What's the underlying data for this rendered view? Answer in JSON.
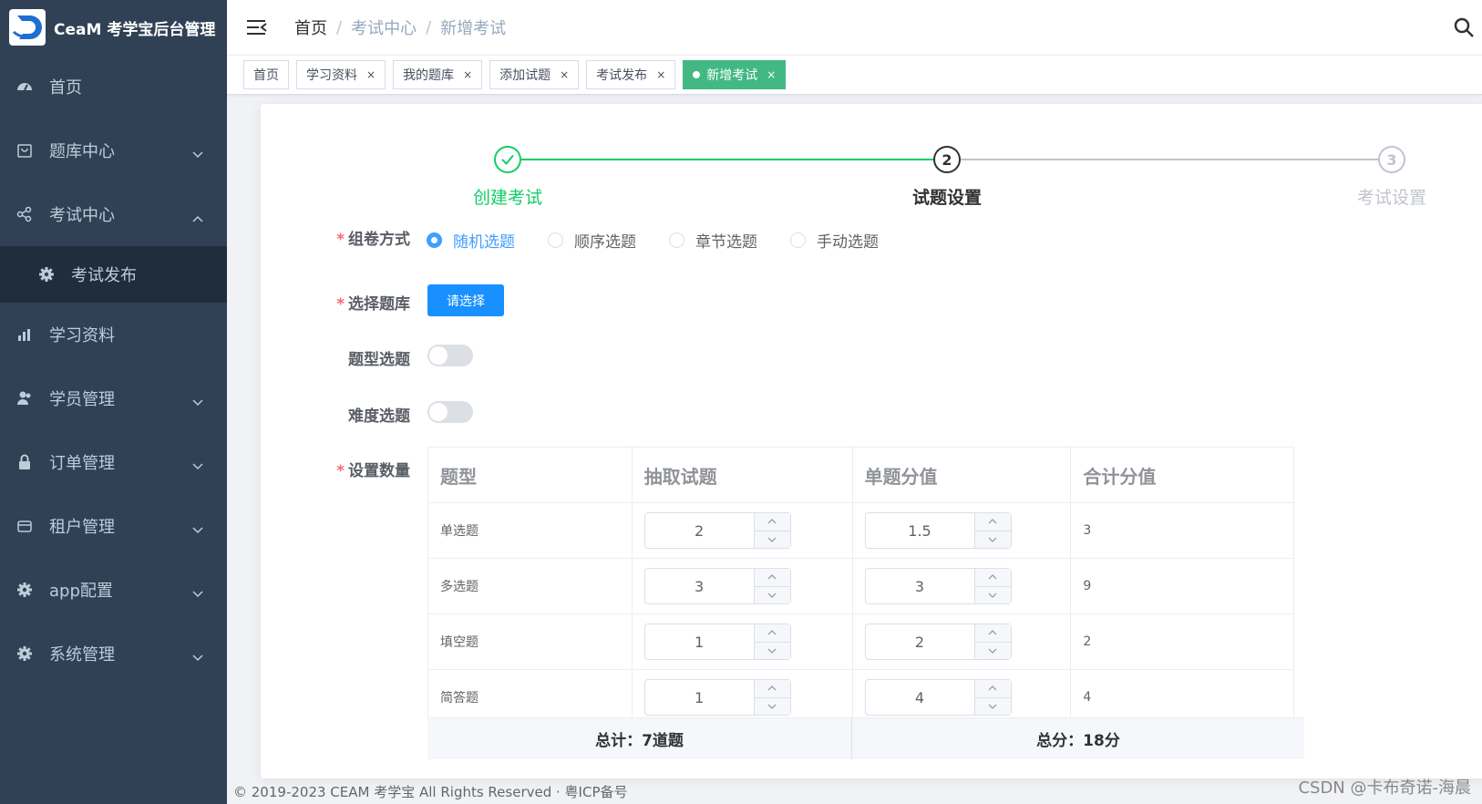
{
  "app": {
    "title": "CeaM 考学宝后台管理"
  },
  "sidebar": {
    "items": [
      {
        "label": "首页",
        "icon": "dashboard-icon",
        "arrow": ""
      },
      {
        "label": "题库中心",
        "icon": "shopping-icon",
        "arrow": "down"
      },
      {
        "label": "考试中心",
        "icon": "share-icon",
        "arrow": "up"
      },
      {
        "label": "学习资料",
        "icon": "chart-icon",
        "arrow": ""
      },
      {
        "label": "学员管理",
        "icon": "peoples-icon",
        "arrow": "down"
      },
      {
        "label": "订单管理",
        "icon": "lock-icon",
        "arrow": "down"
      },
      {
        "label": "租户管理",
        "icon": "card-icon",
        "arrow": "down"
      },
      {
        "label": "app配置",
        "icon": "gear-icon",
        "arrow": "down"
      },
      {
        "label": "系统管理",
        "icon": "gear-icon",
        "arrow": "down"
      }
    ],
    "subitem": {
      "label": "考试发布",
      "icon": "gear-icon"
    }
  },
  "breadcrumb": {
    "home": "首页",
    "sep": "/",
    "section": "考试中心",
    "current": "新增考试"
  },
  "tags": [
    {
      "label": "首页",
      "closable": false
    },
    {
      "label": "学习资料",
      "closable": true
    },
    {
      "label": "我的题库",
      "closable": true
    },
    {
      "label": "添加试题",
      "closable": true
    },
    {
      "label": "考试发布",
      "closable": true
    },
    {
      "label": "新增考试",
      "closable": true,
      "active": true
    }
  ],
  "tag_close": "×",
  "steps": [
    {
      "index": "✓",
      "title": "创建考试",
      "status": "success"
    },
    {
      "index": "2",
      "title": "试题设置",
      "status": "process"
    },
    {
      "index": "3",
      "title": "考试设置",
      "status": "wait"
    }
  ],
  "form": {
    "required_mark": "*",
    "method_label": "组卷方式",
    "method_options": [
      "随机选题",
      "顺序选题",
      "章节选题",
      "手动选题"
    ],
    "method_selected": "随机选题",
    "bank_label": "选择题库",
    "bank_button": "请选择",
    "type_switch_label": "题型选题",
    "type_switch_on": false,
    "difficulty_switch_label": "难度选题",
    "difficulty_switch_on": false,
    "count_label": "设置数量"
  },
  "table": {
    "headers": [
      "题型",
      "抽取试题",
      "单题分值",
      "合计分值"
    ],
    "rows": [
      {
        "type": "单选题",
        "count": "2",
        "score": "1.5",
        "total": "3"
      },
      {
        "type": "多选题",
        "count": "3",
        "score": "3",
        "total": "9"
      },
      {
        "type": "填空题",
        "count": "1",
        "score": "2",
        "total": "2"
      },
      {
        "type": "简答题",
        "count": "1",
        "score": "4",
        "total": "4"
      }
    ],
    "total_questions": "总计：7道题",
    "total_score": "总分：18分"
  },
  "footer": {
    "copyright": "© 2019-2023 CEAM 考学宝 All Rights Reserved · 粤ICP备号"
  },
  "watermark": "CSDN @卡布奇诺-海晨",
  "colors": {
    "sidebar_bg": "#304156",
    "active_tag": "#42b983",
    "primary": "#409eff",
    "success": "#13ce66"
  }
}
